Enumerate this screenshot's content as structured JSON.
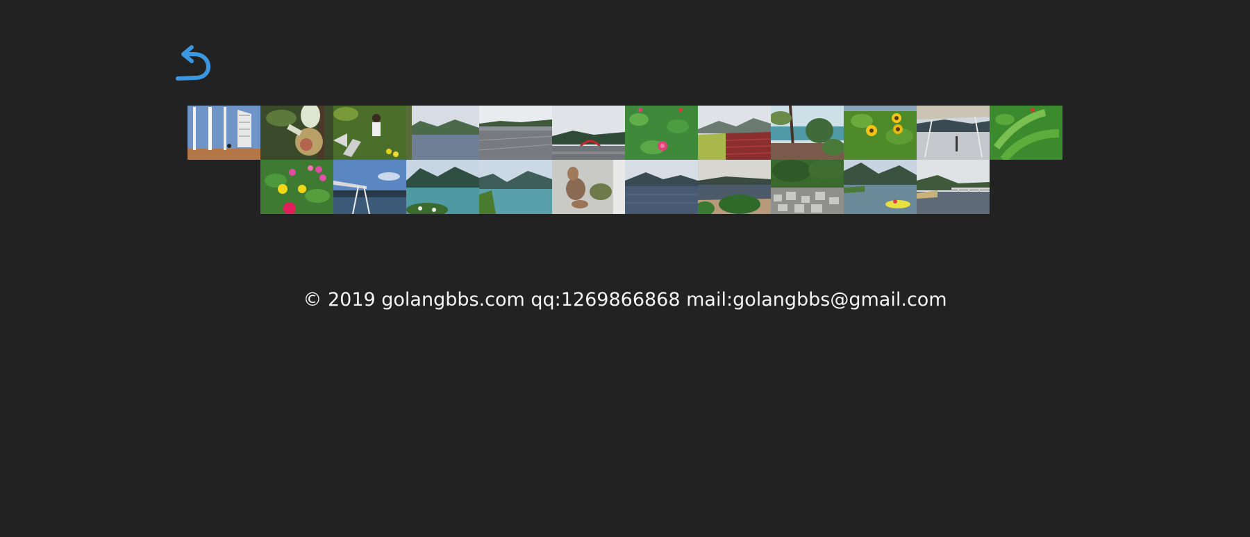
{
  "nav": {
    "back_icon": "undo-arrow-icon",
    "accent_color": "#3a97e0"
  },
  "gallery": {
    "rows": [
      [
        "photo-sails-sculpture",
        "photo-peach-on-branch",
        "photo-child-in-garden",
        "photo-lake-shore",
        "photo-lakeside-road",
        "photo-red-bridge",
        "photo-zinnia-flowers",
        "photo-terraced-fields",
        "photo-lake-trees",
        "photo-sunflowers",
        "photo-pavilion-canopy",
        "photo-green-leaves"
      ],
      [
        "photo-zinnia-bed",
        "photo-swing-frame",
        "photo-lake-mountains",
        "photo-lake-valley",
        "photo-ginger-roots",
        "photo-calm-lake",
        "photo-lake-grasses",
        "photo-stone-riverbank",
        "photo-river-boat",
        "photo-bridge-lake"
      ]
    ]
  },
  "footer": {
    "text": "© 2019 golangbbs.com qq:1269866868 mail:golangbbs@gmail.com",
    "color": "#f4f4f4"
  },
  "page": {
    "background": "#222222"
  }
}
